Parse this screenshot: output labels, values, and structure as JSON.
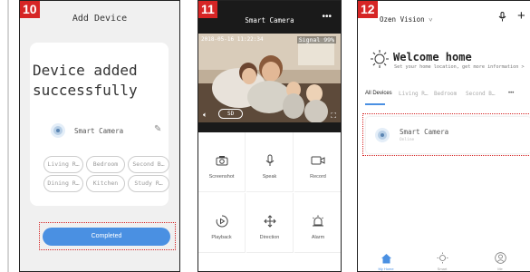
{
  "panels": {
    "p10": {
      "badge": "10",
      "title": "Add Device",
      "heading": "Device added successfully",
      "device_name": "Smart Camera",
      "rooms": [
        "Living R…",
        "Bedroom",
        "Second B…",
        "Dining R…",
        "Kitchen",
        "Study R…"
      ],
      "button": "Completed"
    },
    "p11": {
      "badge": "11",
      "title": "Smart Camera",
      "more": "•••",
      "timestamp": "2018-05-16 11:22:34",
      "signal": "Signal 99%",
      "quality": "SD",
      "controls": [
        {
          "label": "Screenshot",
          "icon": "camera-icon"
        },
        {
          "label": "Speak",
          "icon": "microphone-icon"
        },
        {
          "label": "Record",
          "icon": "video-record-icon"
        },
        {
          "label": "Playback",
          "icon": "playback-icon"
        },
        {
          "label": "Direction",
          "icon": "direction-icon"
        },
        {
          "label": "Alarm",
          "icon": "alarm-icon"
        }
      ]
    },
    "p12": {
      "badge": "12",
      "brand": "Ozen Vision",
      "chevron": "˅",
      "plus": "+",
      "welcome": "Welcome home",
      "subtitle": "Set your home location, get more information >",
      "tabs": [
        "All Devices",
        "Living R…",
        "Bedroom",
        "Second B…"
      ],
      "tabs_more": "•••",
      "device_name": "Smart Camera",
      "device_status": "Online",
      "nav": [
        {
          "label": "My Home",
          "icon": "home-icon"
        },
        {
          "label": "Smart",
          "icon": "smart-sun-icon"
        },
        {
          "label": "Me",
          "icon": "profile-icon"
        }
      ]
    }
  },
  "colors": {
    "accent": "#4a90e2",
    "highlight": "#d62525"
  }
}
